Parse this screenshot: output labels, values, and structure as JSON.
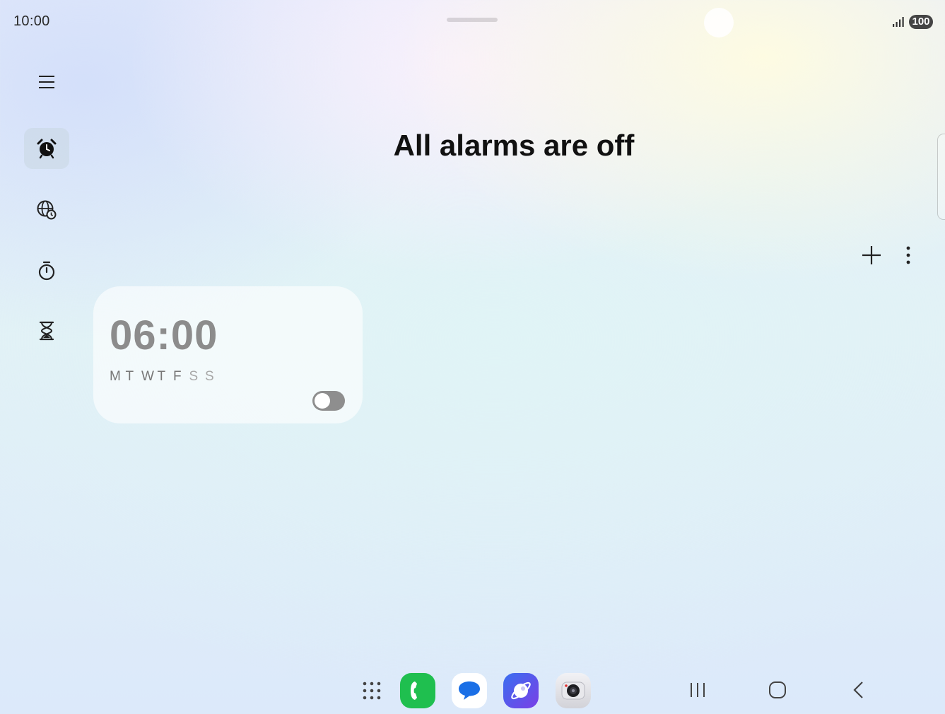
{
  "status_bar": {
    "time": "10:00",
    "battery": "100",
    "signal_icon": "signal-bars-icon"
  },
  "nav_rail": {
    "items": [
      {
        "id": "menu",
        "icon": "hamburger-menu-icon",
        "active": false
      },
      {
        "id": "alarm",
        "icon": "alarm-clock-icon",
        "active": true
      },
      {
        "id": "world-clock",
        "icon": "globe-clock-icon",
        "active": false
      },
      {
        "id": "stopwatch",
        "icon": "stopwatch-icon",
        "active": false
      },
      {
        "id": "timer",
        "icon": "hourglass-icon",
        "active": false
      }
    ]
  },
  "header": {
    "title": "All alarms are off"
  },
  "toolbar": {
    "add_icon": "plus-icon",
    "more_icon": "more-vertical-icon"
  },
  "alarms": [
    {
      "time": "06:00",
      "days": [
        {
          "label": "M",
          "active": true
        },
        {
          "label": "T",
          "active": true
        },
        {
          "label": "W",
          "active": true
        },
        {
          "label": "T",
          "active": true
        },
        {
          "label": "F",
          "active": true
        },
        {
          "label": "S",
          "active": false
        },
        {
          "label": "S",
          "active": false
        }
      ],
      "enabled": false
    }
  ],
  "dock": {
    "apps": [
      {
        "name": "apps-grid",
        "icon": "apps-grid-icon"
      },
      {
        "name": "phone",
        "icon": "phone-icon",
        "color": "#1fbf4f"
      },
      {
        "name": "messages",
        "icon": "message-icon",
        "color": "#1a6fe6"
      },
      {
        "name": "internet",
        "icon": "browser-planet-icon",
        "color": "#5a45e8"
      },
      {
        "name": "camera",
        "icon": "camera-icon",
        "color": "#d8d8de"
      }
    ],
    "system_nav": [
      {
        "name": "recents",
        "icon": "recents-icon"
      },
      {
        "name": "home",
        "icon": "home-icon"
      },
      {
        "name": "back",
        "icon": "back-chevron-icon"
      }
    ]
  },
  "colors": {
    "title_text": "#111111",
    "alarm_inactive_text": "#8c8c8c",
    "toggle_off": "#8e8e8e",
    "active_nav_bg": "#c8d7e2"
  }
}
